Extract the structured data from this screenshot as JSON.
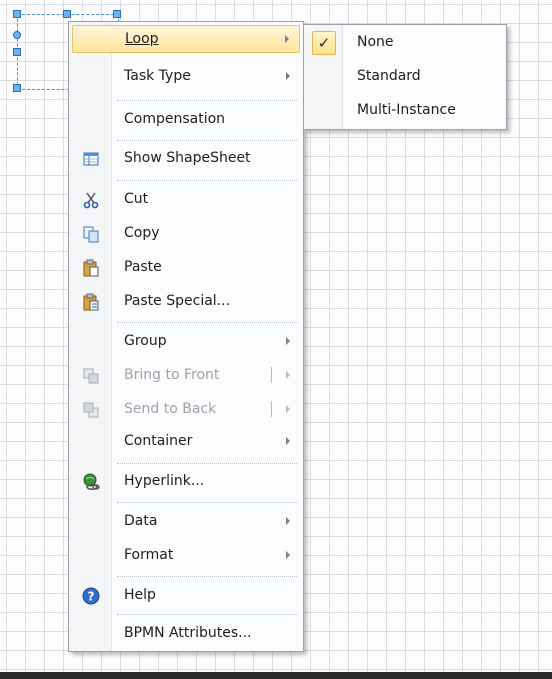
{
  "canvas": {
    "grid_color": "#d8dde3",
    "selection_color": "#4a8fd6"
  },
  "context_menu": {
    "items": [
      {
        "label": "Loop",
        "has_submenu": true,
        "highlighted": true,
        "enabled": true
      },
      {
        "label": "Task Type",
        "has_submenu": true,
        "enabled": true
      },
      {
        "label": "Compensation",
        "has_submenu": false,
        "enabled": true
      },
      {
        "label": "Show ShapeSheet",
        "icon": "shapesheet-icon",
        "enabled": true
      },
      {
        "label": "Cut",
        "icon": "scissors-icon",
        "enabled": true
      },
      {
        "label": "Copy",
        "icon": "copy-icon",
        "enabled": true
      },
      {
        "label": "Paste",
        "icon": "paste-icon",
        "enabled": true
      },
      {
        "label": "Paste Special...",
        "icon": "paste-special-icon",
        "enabled": true
      },
      {
        "label": "Group",
        "has_submenu": true,
        "enabled": true
      },
      {
        "label": "Bring to Front",
        "icon": "bring-to-front-icon",
        "has_submenu": true,
        "split": true,
        "enabled": false
      },
      {
        "label": "Send to Back",
        "icon": "send-to-back-icon",
        "has_submenu": true,
        "split": true,
        "enabled": false
      },
      {
        "label": "Container",
        "has_submenu": true,
        "enabled": true
      },
      {
        "label": "Hyperlink...",
        "icon": "hyperlink-icon",
        "enabled": true
      },
      {
        "label": "Data",
        "has_submenu": true,
        "enabled": true
      },
      {
        "label": "Format",
        "has_submenu": true,
        "enabled": true
      },
      {
        "label": "Help",
        "icon": "help-icon",
        "enabled": true
      },
      {
        "label": "BPMN Attributes...",
        "enabled": true
      }
    ]
  },
  "loop_submenu": {
    "items": [
      {
        "label": "None",
        "checked": true
      },
      {
        "label": "Standard",
        "checked": false
      },
      {
        "label": "Multi-Instance",
        "checked": false
      }
    ],
    "check_glyph": "✓"
  },
  "colors": {
    "highlight": "#ffe69a",
    "disabled_text": "#a0a4a8",
    "menu_background": "#fbfcfd"
  }
}
